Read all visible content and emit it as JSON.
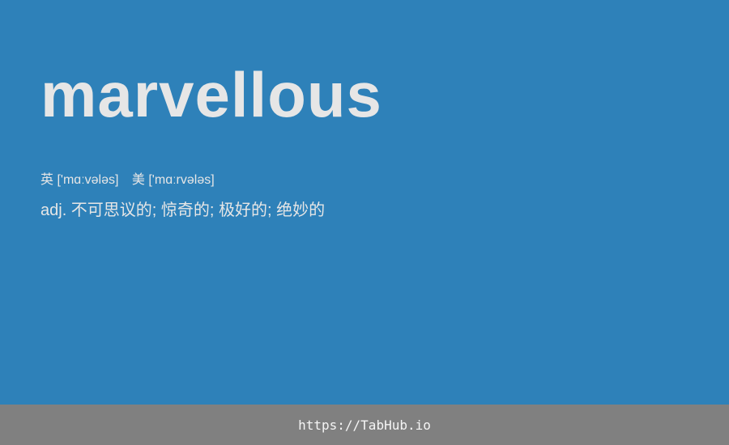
{
  "word": "marvellous",
  "pronunciation": {
    "uk_label": "英",
    "uk_ipa": "['mɑːvələs]",
    "us_label": "美",
    "us_ipa": "['mɑːrvələs]"
  },
  "definition": "adj. 不可思议的; 惊奇的; 极好的; 绝妙的",
  "footer": {
    "link_text": "https://TabHub.io"
  },
  "colors": {
    "background": "#2e81b9",
    "text": "#e6e6e6",
    "footer_background": "#808080"
  }
}
